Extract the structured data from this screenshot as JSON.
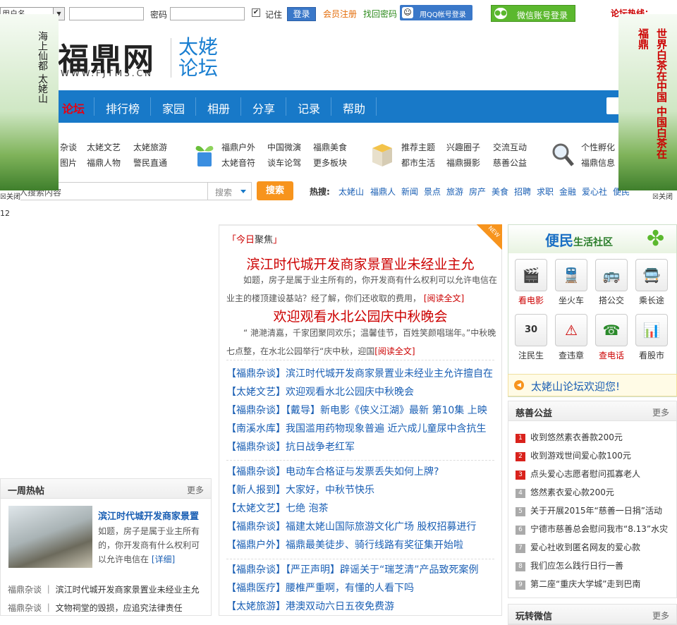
{
  "topbar": {
    "user_select_value": "用户名",
    "password_label": "密码",
    "remember_label": "记住",
    "login_button": "登录",
    "register_link": "会员注册",
    "find_password_link": "找回密码",
    "qq_login": "用QQ帐号登录",
    "wechat_login": "微信账号登录",
    "hotline": "论坛热线："
  },
  "header": {
    "logo_text": "福鼎网",
    "logo_url_text": "WWW.FJTMS.CN",
    "logo_sub": "太姥论坛"
  },
  "nav": {
    "items": [
      "论坛",
      "排行榜",
      "家园",
      "相册",
      "分享",
      "记录",
      "帮助"
    ]
  },
  "subnav": {
    "group1": [
      "杂谈",
      "太姥文艺",
      "太姥旅游",
      "图片",
      "福鼎人物",
      "警民直通"
    ],
    "group2": [
      "福鼎户外",
      "中国微演",
      "福鼎美食",
      "太姥音符",
      "谈车论驾",
      "更多板块"
    ],
    "group3": [
      "推荐主题",
      "兴趣圈子",
      "交流互动",
      "都市生活",
      "福鼎摄影",
      "慈善公益"
    ],
    "group4": [
      "个性孵化",
      "福鼎信息"
    ]
  },
  "search": {
    "placeholder": "请输入搜索内容",
    "type": "搜索",
    "button": "搜索",
    "hot_label": "热搜:",
    "hot_words": [
      "太姥山",
      "福鼎人",
      "新闻",
      "景点",
      "旅游",
      "房产",
      "美食",
      "招聘",
      "求职",
      "金融",
      "爱心社",
      "便民"
    ]
  },
  "side_ads": {
    "left_text": "海上仙都 太姥山",
    "right_text": "世界白茶在中国 中国白茶在福鼎",
    "close_label": "关闭"
  },
  "misc_number": "12",
  "featured": {
    "tag_prefix": "今日",
    "tag_main": "聚焦",
    "new_badge": "NEW",
    "headline1": "滨江时代城开发商家景置业未经业主允",
    "desc1": "如题，房子是属于业主所有的，你开发商有什么权利可以允许电信在业主的楼顶建设基站？经了解，你们还收取的费用，",
    "headline2": "欢迎观看水北公园庆中秋晚会",
    "desc2": "“ 滟滟清嘉，千家团聚同欢乐；温馨佳节，百姓笑颜唱瑞年。”中秋晚七点整，在水北公园举行“庆中秋，迎国",
    "read_more": "[阅读全文]",
    "list1": [
      "【福鼎杂谈】滨江时代城开发商家景置业未经业主允许擅自在",
      "【太姥文艺】欢迎观看水北公园庆中秋晚会",
      "【福鼎杂谈】【戴导】新电影《侠义江湖》最新 第10集 上映",
      "【南溪水库】我国滥用药物现象普遍 近六成儿童尿中含抗生",
      "【福鼎杂谈】抗日战争老红军"
    ],
    "list2": [
      "【福鼎杂谈】电动车合格证与发票丢失如何上牌?",
      "【新人报到】大家好，中秋节快乐",
      "【太姥文艺】七绝 泡茶",
      "【福鼎杂谈】福建太姥山国际旅游文化广场 股权招募进行",
      "【福鼎户外】福鼎最美徒步、骑行线路有奖征集开始啦"
    ],
    "list3": [
      "【福鼎杂谈】【严正声明】辟谣关于“瑞芝清”产品致死案例",
      "【福鼎医疗】腰椎严重啊，有懂的人看下吗",
      "【太姥旅游】港澳双动六日五夜免费游"
    ]
  },
  "weekly": {
    "title": "一周热帖",
    "more": "更多",
    "top_title": "滨江时代城开发商家景置",
    "top_desc": "如题，房子是属于业主所有的，你开发商有什么权利可以允许电信在",
    "detail": "[详细]",
    "items": [
      {
        "cat": "福鼎杂谈",
        "text": "滨江时代城开发商家景置业未经业主允"
      },
      {
        "cat": "福鼎杂谈",
        "text": "文物祠堂的毁损，应追究法律责任"
      }
    ]
  },
  "life": {
    "title_main": "便民",
    "title_sub": "生活社区",
    "services": [
      "看电影",
      "坐火车",
      "搭公交",
      "乘长途",
      "注民生",
      "查违章",
      "查电话",
      "看股市"
    ],
    "calendar_day": "30",
    "welcome": "太姥山论坛欢迎您!"
  },
  "charity": {
    "title": "慈善公益",
    "more": "更多",
    "items": [
      "收到悠然素衣善款200元",
      "收到游戏世间爱心款100元",
      "点头爱心志愿者慰问孤寡老人",
      "悠然素衣爱心款200元",
      "关于开展2015年“慈善一日捐”活动",
      "宁德市慈善总会慰问我市“8.13”水灾",
      "爱心社收到匿名网友的爱心款",
      "我们应怎么践行日行一善",
      "第二座“重庆大学城”走到巴南"
    ]
  },
  "wechat_panel": {
    "title": "玩转微信",
    "more": "更多"
  },
  "colors": {
    "nav_blue": "#1879c8",
    "accent_red": "#c00000",
    "link_blue": "#1a5fb4",
    "search_orange": "#f7941d",
    "wechat_green": "#5bb82e"
  }
}
